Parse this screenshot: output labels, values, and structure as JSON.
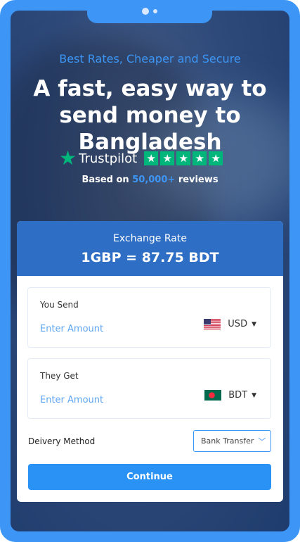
{
  "hero": {
    "tagline": "Best Rates, Cheaper and Secure",
    "headline": "A fast, easy way to send money to Bangladesh"
  },
  "trustpilot": {
    "name": "Trustpilot",
    "rating_stars": 5,
    "reviews_prefix": "Based on",
    "reviews_count": "50,000+",
    "reviews_suffix": "reviews",
    "accent_color": "#00b67a"
  },
  "exchange": {
    "label": "Exchange Rate",
    "value": "1GBP = 87.75 BDT"
  },
  "send": {
    "label": "You Send",
    "placeholder": "Enter Amount",
    "currency": "USD"
  },
  "get": {
    "label": "They Get",
    "placeholder": "Enter Amount",
    "currency": "BDT"
  },
  "delivery": {
    "label": "Deivery Method",
    "selected": "Bank Transfer"
  },
  "continue_label": "Continue",
  "colors": {
    "primary": "#3d96f5",
    "header_blue": "#2e6ec5",
    "button_blue": "#2b92f5"
  }
}
